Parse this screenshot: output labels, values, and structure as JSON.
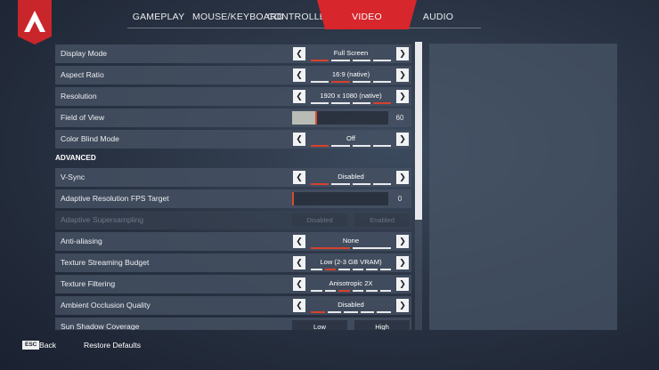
{
  "brand": {
    "color": "#d7262c",
    "logo_name": "apex-logo"
  },
  "tabs": [
    {
      "label": "GAMEPLAY",
      "active": false
    },
    {
      "label": "MOUSE/KEYBOARD",
      "active": false
    },
    {
      "label": "CONTROLLER",
      "active": false
    },
    {
      "label": "VIDEO",
      "active": true
    },
    {
      "label": "AUDIO",
      "active": false
    }
  ],
  "settings": {
    "display_mode": {
      "label": "Display Mode",
      "value": "Full Screen",
      "option_count": 4,
      "selected_index": 0
    },
    "aspect_ratio": {
      "label": "Aspect Ratio",
      "value": "16:9 (native)",
      "option_count": 4,
      "selected_index": 1
    },
    "resolution": {
      "label": "Resolution",
      "value": "1920 x 1080 (native)",
      "option_count": 4,
      "selected_index": 3
    },
    "field_of_view": {
      "label": "Field of View",
      "value": "60",
      "fill_fraction": 0.25
    },
    "color_blind_mode": {
      "label": "Color Blind Mode",
      "value": "Off",
      "option_count": 4,
      "selected_index": 0
    }
  },
  "advanced": {
    "heading": "ADVANCED",
    "vsync": {
      "label": "V-Sync",
      "value": "Disabled",
      "option_count": 4,
      "selected_index": 0
    },
    "adaptive_fps": {
      "label": "Adaptive Resolution FPS Target",
      "value": "0",
      "fill_fraction": 0.0
    },
    "adaptive_supersampling": {
      "label": "Adaptive Supersampling",
      "option_a": "Disabled",
      "option_b": "Enabled",
      "enabled": false
    },
    "anti_aliasing": {
      "label": "Anti-aliasing",
      "value": "None",
      "option_count": 2,
      "selected_index": 0
    },
    "texture_budget": {
      "label": "Texture Streaming Budget",
      "value": "Low (2-3 GB VRAM)",
      "option_count": 6,
      "selected_index": 1
    },
    "texture_filtering": {
      "label": "Texture Filtering",
      "value": "Anisotropic 2X",
      "option_count": 6,
      "selected_index": 2
    },
    "ambient_occlusion": {
      "label": "Ambient Occlusion Quality",
      "value": "Disabled",
      "option_count": 5,
      "selected_index": 0
    },
    "sun_shadow": {
      "label": "Sun Shadow Coverage",
      "option_a": "Low",
      "option_b": "High"
    }
  },
  "footer": {
    "esc_key": "ESC",
    "back": "Back",
    "restore": "Restore Defaults"
  }
}
